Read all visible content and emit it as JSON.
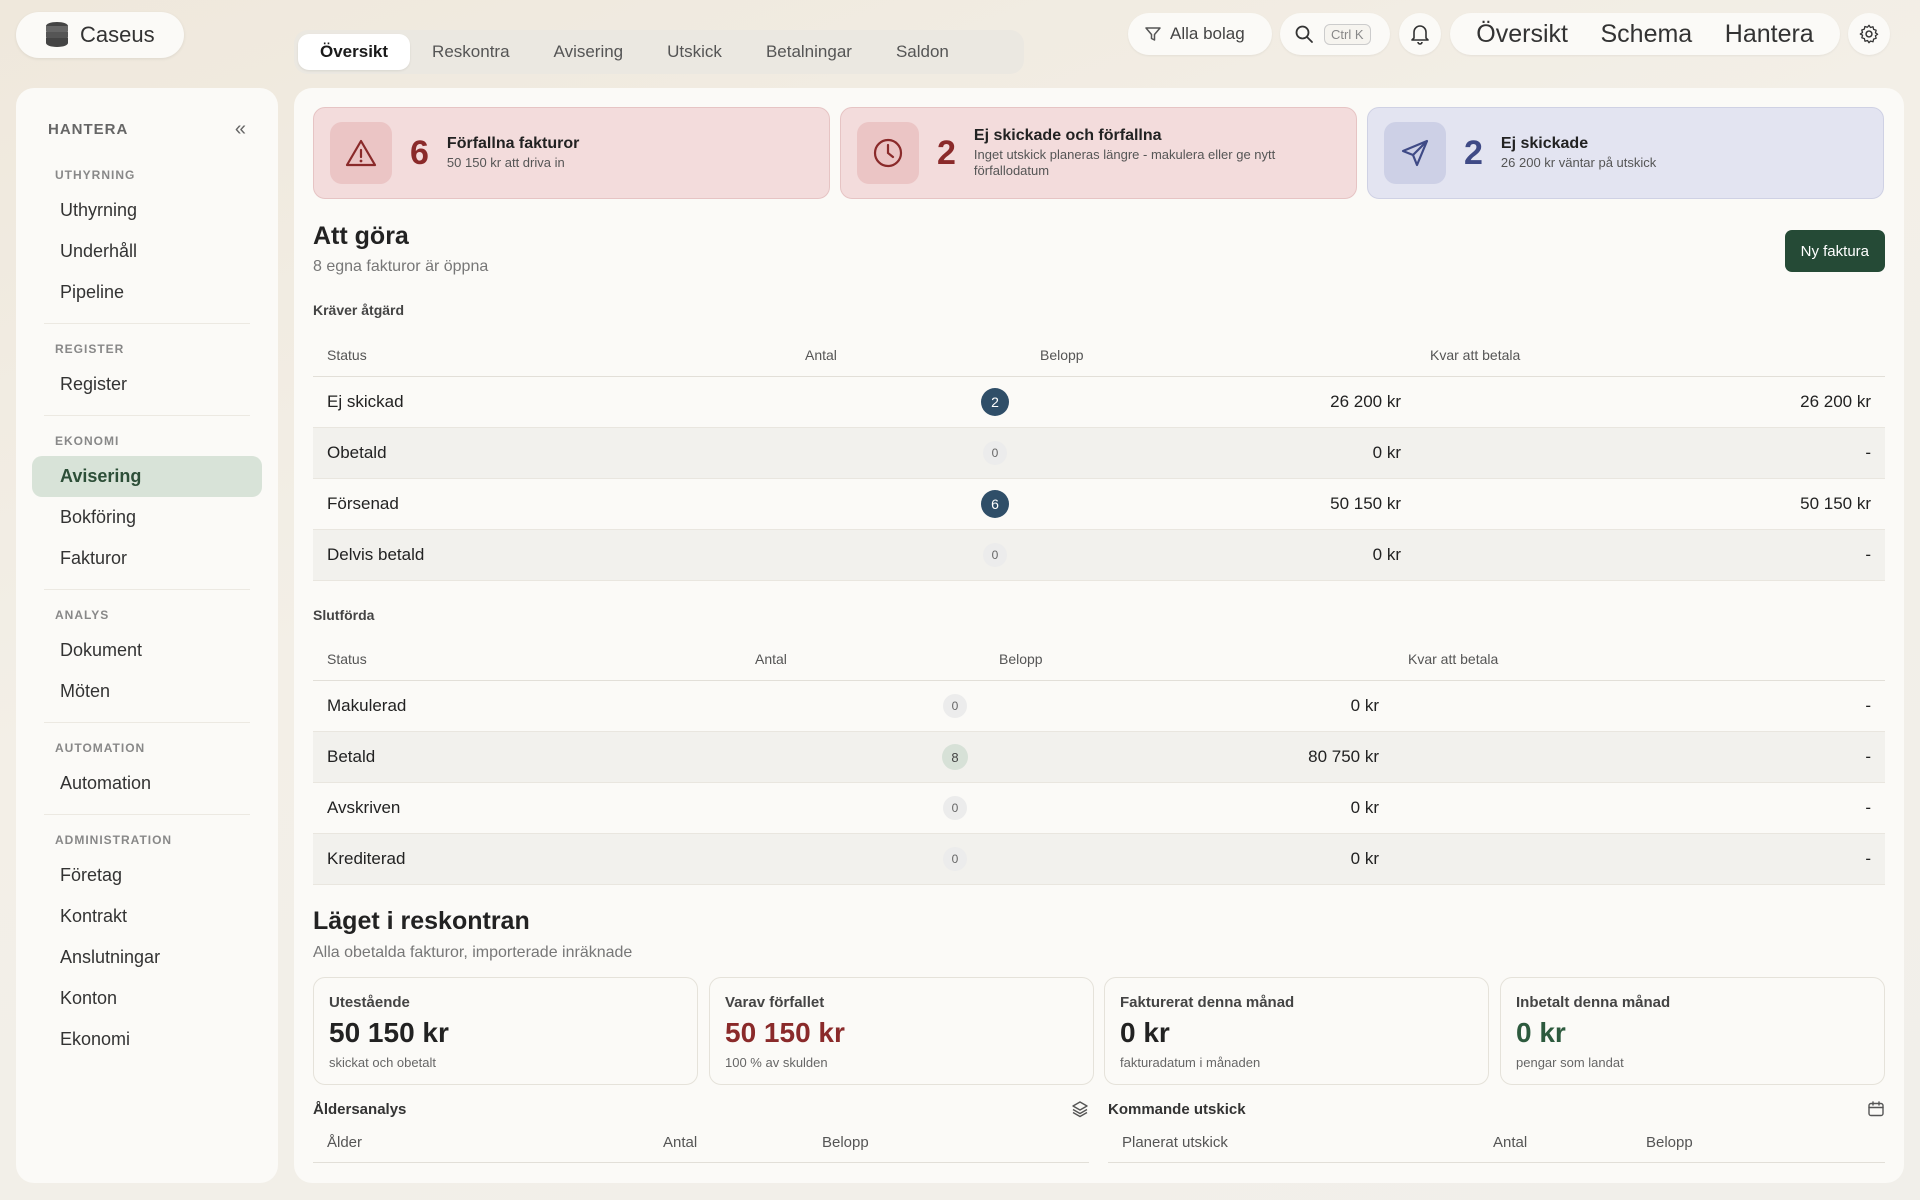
{
  "brand": {
    "name": "Caseus"
  },
  "tabs": [
    {
      "label": "Översikt",
      "active": true
    },
    {
      "label": "Reskontra"
    },
    {
      "label": "Avisering"
    },
    {
      "label": "Utskick"
    },
    {
      "label": "Betalningar"
    },
    {
      "label": "Saldon"
    }
  ],
  "topbar": {
    "filter_label": "Alla bolag",
    "search_shortcut": "Ctrl K",
    "nav": [
      "Översikt",
      "Schema",
      "Hantera"
    ]
  },
  "sidebar": {
    "title": "HANTERA",
    "sections": [
      {
        "label": "UTHYRNING",
        "items": [
          "Uthyrning",
          "Underhåll",
          "Pipeline"
        ]
      },
      {
        "label": "REGISTER",
        "items": [
          "Register"
        ]
      },
      {
        "label": "EKONOMI",
        "items": [
          "Avisering",
          "Bokföring",
          "Fakturor"
        ],
        "active": "Avisering"
      },
      {
        "label": "ANALYS",
        "items": [
          "Dokument",
          "Möten"
        ]
      },
      {
        "label": "AUTOMATION",
        "items": [
          "Automation"
        ]
      },
      {
        "label": "ADMINISTRATION",
        "items": [
          "Företag",
          "Kontrakt",
          "Anslutningar",
          "Konton",
          "Ekonomi"
        ]
      }
    ]
  },
  "alerts": [
    {
      "count": "6",
      "title": "Förfallna fakturor",
      "sub": "50 150 kr att driva in",
      "icon": "warning-icon"
    },
    {
      "count": "2",
      "title": "Ej skickade och förfallna",
      "sub": "Inget utskick planeras längre - makulera eller ge nytt förfallodatum",
      "icon": "clock-icon"
    },
    {
      "count": "2",
      "title": "Ej skickade",
      "sub": "26 200 kr väntar på utskick",
      "icon": "send-icon"
    }
  ],
  "todo": {
    "title": "Att göra",
    "subtitle": "8 egna fakturor är öppna",
    "new_invoice": "Ny faktura",
    "action_label": "Kräver åtgärd",
    "action_headers": [
      "Status",
      "Antal",
      "Belopp",
      "Kvar att betala"
    ],
    "action_rows": [
      {
        "status": "Ej skickad",
        "count": "2",
        "amount": "26 200 kr",
        "remaining": "26 200 kr"
      },
      {
        "status": "Obetald",
        "count": "0",
        "amount": "0 kr",
        "remaining": "-"
      },
      {
        "status": "Försenad",
        "count": "6",
        "amount": "50 150 kr",
        "remaining": "50 150 kr"
      },
      {
        "status": "Delvis betald",
        "count": "0",
        "amount": "0 kr",
        "remaining": "-"
      }
    ],
    "done_label": "Slutförda",
    "done_headers": [
      "Status",
      "Antal",
      "Belopp",
      "Kvar att betala"
    ],
    "done_rows": [
      {
        "status": "Makulerad",
        "count": "0",
        "amount": "0 kr",
        "remaining": "-"
      },
      {
        "status": "Betald",
        "count": "8",
        "amount": "80 750 kr",
        "remaining": "-"
      },
      {
        "status": "Avskriven",
        "count": "0",
        "amount": "0 kr",
        "remaining": "-"
      },
      {
        "status": "Krediterad",
        "count": "0",
        "amount": "0 kr",
        "remaining": "-"
      }
    ]
  },
  "ledger": {
    "title": "Läget i reskontran",
    "subtitle": "Alla obetalda fakturor, importerade inräknade",
    "stats": [
      {
        "title": "Utestående",
        "value": "50 150 kr",
        "sub": "skickat och obetalt"
      },
      {
        "title": "Varav förfallet",
        "value": "50 150 kr",
        "sub": "100 % av skulden"
      },
      {
        "title": "Fakturerat denna månad",
        "value": "0 kr",
        "sub": "fakturadatum i månaden"
      },
      {
        "title": "Inbetalt denna månad",
        "value": "0 kr",
        "sub": "pengar som landat"
      }
    ],
    "aging": {
      "title": "Åldersanalys",
      "headers": [
        "Ålder",
        "Antal",
        "Belopp"
      ]
    },
    "upcoming": {
      "title": "Kommande utskick",
      "headers": [
        "Planerat utskick",
        "Antal",
        "Belopp"
      ]
    }
  }
}
